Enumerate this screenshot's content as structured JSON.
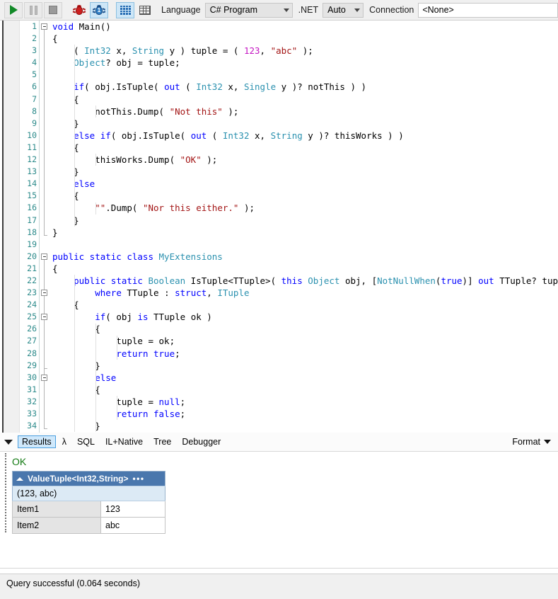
{
  "toolbar": {
    "buttons": [
      {
        "name": "run-button",
        "icon": "play-icon",
        "state": "enabled"
      },
      {
        "name": "pause-button",
        "icon": "pause-icon",
        "state": "disabled"
      },
      {
        "name": "stop-button",
        "icon": "stop-icon",
        "state": "enabled"
      },
      {
        "name": "debug-stop-button",
        "icon": "red-bug-icon",
        "state": "enabled"
      },
      {
        "name": "debug-step-button",
        "icon": "blue-bug-1-icon",
        "state": "selected"
      },
      {
        "name": "results-list-button",
        "icon": "list-grid-icon",
        "state": "selected"
      },
      {
        "name": "results-table-button",
        "icon": "table-icon",
        "state": "enabled"
      }
    ],
    "language_label": "Language",
    "language_value": "C# Program",
    "net_label": ".NET",
    "net_value": "Auto",
    "connection_label": "Connection",
    "connection_value": "<None>"
  },
  "editor": {
    "line_numbers": [
      1,
      2,
      3,
      4,
      5,
      6,
      7,
      8,
      9,
      10,
      11,
      12,
      13,
      14,
      15,
      16,
      17,
      18,
      19,
      20,
      21,
      22,
      23,
      24,
      25,
      26,
      27,
      28,
      29,
      30,
      31,
      32,
      33,
      34
    ],
    "lines": [
      {
        "n": 1,
        "tokens": [
          {
            "t": "void ",
            "c": "kw"
          },
          {
            "t": "Main()",
            "c": "plain"
          }
        ]
      },
      {
        "n": 2,
        "tokens": [
          {
            "t": "{",
            "c": "plain"
          }
        ]
      },
      {
        "n": 3,
        "tokens": [
          {
            "t": "    ( ",
            "c": "plain"
          },
          {
            "t": "Int32",
            "c": "typ"
          },
          {
            "t": " x, ",
            "c": "plain"
          },
          {
            "t": "String",
            "c": "typ"
          },
          {
            "t": " y ) tuple = ( ",
            "c": "plain"
          },
          {
            "t": "123",
            "c": "num"
          },
          {
            "t": ", ",
            "c": "plain"
          },
          {
            "t": "\"abc\"",
            "c": "str"
          },
          {
            "t": " );",
            "c": "plain"
          }
        ]
      },
      {
        "n": 4,
        "tokens": [
          {
            "t": "    ",
            "c": "plain"
          },
          {
            "t": "Object",
            "c": "typ"
          },
          {
            "t": "? obj = tuple;",
            "c": "plain"
          }
        ]
      },
      {
        "n": 5,
        "tokens": []
      },
      {
        "n": 6,
        "tokens": [
          {
            "t": "    ",
            "c": "plain"
          },
          {
            "t": "if",
            "c": "kw"
          },
          {
            "t": "( obj.IsTuple( ",
            "c": "plain"
          },
          {
            "t": "out",
            "c": "kw"
          },
          {
            "t": " ( ",
            "c": "plain"
          },
          {
            "t": "Int32",
            "c": "typ"
          },
          {
            "t": " x, ",
            "c": "plain"
          },
          {
            "t": "Single",
            "c": "typ"
          },
          {
            "t": " y )? notThis ) )",
            "c": "plain"
          }
        ]
      },
      {
        "n": 7,
        "tokens": [
          {
            "t": "    {",
            "c": "plain"
          }
        ]
      },
      {
        "n": 8,
        "tokens": [
          {
            "t": "        notThis.Dump( ",
            "c": "plain"
          },
          {
            "t": "\"Not this\"",
            "c": "str"
          },
          {
            "t": " );",
            "c": "plain"
          }
        ]
      },
      {
        "n": 9,
        "tokens": [
          {
            "t": "    }",
            "c": "plain"
          }
        ]
      },
      {
        "n": 10,
        "tokens": [
          {
            "t": "    ",
            "c": "plain"
          },
          {
            "t": "else",
            "c": "kw"
          },
          {
            "t": " ",
            "c": "plain"
          },
          {
            "t": "if",
            "c": "kw"
          },
          {
            "t": "( obj.IsTuple( ",
            "c": "plain"
          },
          {
            "t": "out",
            "c": "kw"
          },
          {
            "t": " ( ",
            "c": "plain"
          },
          {
            "t": "Int32",
            "c": "typ"
          },
          {
            "t": " x, ",
            "c": "plain"
          },
          {
            "t": "String",
            "c": "typ"
          },
          {
            "t": " y )? thisWorks ) )",
            "c": "plain"
          }
        ]
      },
      {
        "n": 11,
        "tokens": [
          {
            "t": "    {",
            "c": "plain"
          }
        ]
      },
      {
        "n": 12,
        "tokens": [
          {
            "t": "        thisWorks.Dump( ",
            "c": "plain"
          },
          {
            "t": "\"OK\"",
            "c": "str"
          },
          {
            "t": " );",
            "c": "plain"
          }
        ]
      },
      {
        "n": 13,
        "tokens": [
          {
            "t": "    }",
            "c": "plain"
          }
        ]
      },
      {
        "n": 14,
        "tokens": [
          {
            "t": "    ",
            "c": "plain"
          },
          {
            "t": "else",
            "c": "kw"
          }
        ]
      },
      {
        "n": 15,
        "tokens": [
          {
            "t": "    {",
            "c": "plain"
          }
        ]
      },
      {
        "n": 16,
        "tokens": [
          {
            "t": "        ",
            "c": "plain"
          },
          {
            "t": "\"\"",
            "c": "str"
          },
          {
            "t": ".Dump( ",
            "c": "plain"
          },
          {
            "t": "\"Nor this either.\"",
            "c": "str"
          },
          {
            "t": " );",
            "c": "plain"
          }
        ]
      },
      {
        "n": 17,
        "tokens": [
          {
            "t": "    }",
            "c": "plain"
          }
        ]
      },
      {
        "n": 18,
        "tokens": [
          {
            "t": "}",
            "c": "plain"
          }
        ]
      },
      {
        "n": 19,
        "tokens": []
      },
      {
        "n": 20,
        "tokens": [
          {
            "t": "public static class ",
            "c": "kw"
          },
          {
            "t": "MyExtensions",
            "c": "typ"
          }
        ]
      },
      {
        "n": 21,
        "tokens": [
          {
            "t": "{",
            "c": "plain"
          }
        ]
      },
      {
        "n": 22,
        "tokens": [
          {
            "t": "    ",
            "c": "plain"
          },
          {
            "t": "public static ",
            "c": "kw"
          },
          {
            "t": "Boolean",
            "c": "typ"
          },
          {
            "t": " IsTuple<TTuple>( ",
            "c": "plain"
          },
          {
            "t": "this",
            "c": "kw"
          },
          {
            "t": " ",
            "c": "plain"
          },
          {
            "t": "Object",
            "c": "typ"
          },
          {
            "t": " obj, [",
            "c": "plain"
          },
          {
            "t": "NotNullWhen",
            "c": "typ"
          },
          {
            "t": "(",
            "c": "plain"
          },
          {
            "t": "true",
            "c": "kw"
          },
          {
            "t": ")] ",
            "c": "plain"
          },
          {
            "t": "out",
            "c": "kw"
          },
          {
            "t": " TTuple? tuple )",
            "c": "plain"
          }
        ]
      },
      {
        "n": 23,
        "tokens": [
          {
            "t": "        ",
            "c": "plain"
          },
          {
            "t": "where",
            "c": "kw"
          },
          {
            "t": " TTuple : ",
            "c": "plain"
          },
          {
            "t": "struct",
            "c": "kw"
          },
          {
            "t": ", ",
            "c": "plain"
          },
          {
            "t": "ITuple",
            "c": "typ"
          }
        ]
      },
      {
        "n": 24,
        "tokens": [
          {
            "t": "    {",
            "c": "plain"
          }
        ]
      },
      {
        "n": 25,
        "tokens": [
          {
            "t": "        ",
            "c": "plain"
          },
          {
            "t": "if",
            "c": "kw"
          },
          {
            "t": "( obj ",
            "c": "plain"
          },
          {
            "t": "is",
            "c": "kw"
          },
          {
            "t": " TTuple ok )",
            "c": "plain"
          }
        ]
      },
      {
        "n": 26,
        "tokens": [
          {
            "t": "        {",
            "c": "plain"
          }
        ]
      },
      {
        "n": 27,
        "tokens": [
          {
            "t": "            tuple = ok;",
            "c": "plain"
          }
        ]
      },
      {
        "n": 28,
        "tokens": [
          {
            "t": "            ",
            "c": "plain"
          },
          {
            "t": "return true",
            "c": "kw"
          },
          {
            "t": ";",
            "c": "plain"
          }
        ]
      },
      {
        "n": 29,
        "tokens": [
          {
            "t": "        }",
            "c": "plain"
          }
        ]
      },
      {
        "n": 30,
        "tokens": [
          {
            "t": "        ",
            "c": "plain"
          },
          {
            "t": "else",
            "c": "kw"
          }
        ]
      },
      {
        "n": 31,
        "tokens": [
          {
            "t": "        {",
            "c": "plain"
          }
        ]
      },
      {
        "n": 32,
        "tokens": [
          {
            "t": "            tuple = ",
            "c": "plain"
          },
          {
            "t": "null",
            "c": "kw"
          },
          {
            "t": ";",
            "c": "plain"
          }
        ]
      },
      {
        "n": 33,
        "tokens": [
          {
            "t": "            ",
            "c": "plain"
          },
          {
            "t": "return false",
            "c": "kw"
          },
          {
            "t": ";",
            "c": "plain"
          }
        ]
      },
      {
        "n": 34,
        "tokens": [
          {
            "t": "        }",
            "c": "plain"
          }
        ]
      }
    ]
  },
  "results_tabs": {
    "collapse_icon": "triangle-down-icon",
    "tabs": [
      {
        "label": "Results",
        "active": true
      },
      {
        "label": "λ",
        "active": false
      },
      {
        "label": "SQL",
        "active": false
      },
      {
        "label": "IL+Native",
        "active": false
      },
      {
        "label": "Tree",
        "active": false
      },
      {
        "label": "Debugger",
        "active": false
      }
    ],
    "format_label": "Format"
  },
  "results": {
    "ok_text": "OK",
    "table_header": "ValueTuple<Int32,String>",
    "menu_dots": "•••",
    "summary": "(123, abc)",
    "rows": [
      {
        "name": "Item1",
        "value": "123"
      },
      {
        "name": "Item2",
        "value": "abc"
      }
    ]
  },
  "statusbar": {
    "text": "Query successful  (0.064 seconds)"
  },
  "colors": {
    "keyword": "#0000ff",
    "type": "#2b91af",
    "string": "#a31515",
    "number": "#c313c1",
    "linenumber": "#2b8a8a",
    "ok_green": "#127a12",
    "header_blue": "#4a77ad",
    "tab_active": "#cfe8fb"
  }
}
